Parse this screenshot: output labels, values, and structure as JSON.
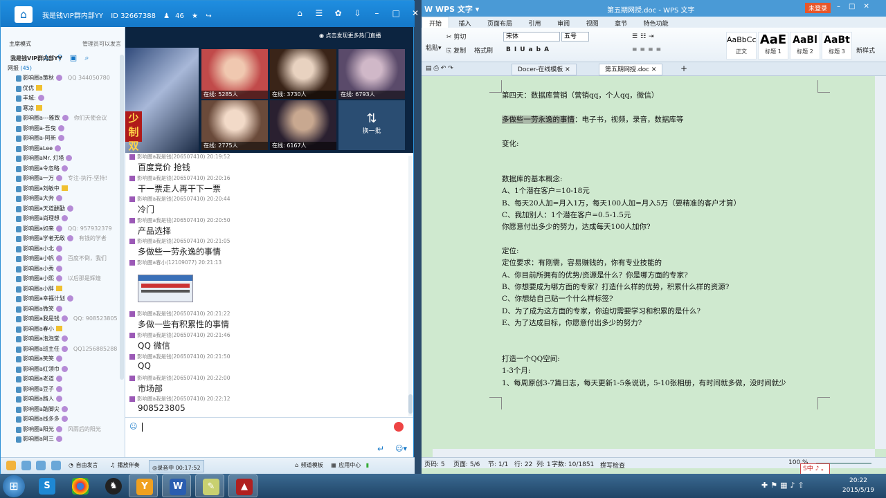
{
  "yy": {
    "title": "我是钱VIP群内部YY",
    "id": "ID 32667388",
    "online": "46",
    "mode": "主席模式",
    "admin_note": "管理员可以发言",
    "tree_root": "我是钱VIP群内部YY",
    "tree_sub": "网报",
    "tree_count": "(45)",
    "members": [
      {
        "name": "影响圈a策秋",
        "extra": "QQ  344050780",
        "badge": "b"
      },
      {
        "name": "优优",
        "extra": "",
        "badge": "g"
      },
      {
        "name": "丰城:",
        "extra": "",
        "badge": "b"
      },
      {
        "name": "寒凉",
        "extra": "",
        "badge": "g"
      },
      {
        "name": "影响圈a---雅致",
        "extra": "你们天使会议",
        "badge": "b"
      },
      {
        "name": "影响圈a-吾曳",
        "extra": "",
        "badge": "b"
      },
      {
        "name": "影响圈a-阿新",
        "extra": "",
        "badge": "b"
      },
      {
        "name": "影响圈aLee",
        "extra": "",
        "badge": "b"
      },
      {
        "name": "影响圈aMr. 灯塔",
        "extra": "",
        "badge": "b"
      },
      {
        "name": "影响圈a令忽略",
        "extra": "",
        "badge": "b"
      },
      {
        "name": "影响圈a一万",
        "extra": "专注-执行-坚持!",
        "badge": "b"
      },
      {
        "name": "影响圈a刘敏中",
        "extra": "",
        "badge": "g"
      },
      {
        "name": "影响圈a大奔",
        "extra": "",
        "badge": "b"
      },
      {
        "name": "影响圈a天道酬勤",
        "extra": "",
        "badge": "b"
      },
      {
        "name": "影响圈a尚理想",
        "extra": "",
        "badge": "b"
      },
      {
        "name": "影响圈a如来",
        "extra": "QQ: 957932379",
        "badge": "b"
      },
      {
        "name": "影响圈a学者无敌",
        "extra": "有钱的学者",
        "badge": "b"
      },
      {
        "name": "影响圈a小北",
        "extra": "",
        "badge": "b"
      },
      {
        "name": "影响圈a小帆",
        "extra": "百度不倒，我们",
        "badge": "b"
      },
      {
        "name": "影响圈a小秀",
        "extra": "",
        "badge": "b"
      },
      {
        "name": "影响圈a小熙",
        "extra": "以后那是辉煌",
        "badge": "b"
      },
      {
        "name": "影响圈a小胖",
        "extra": "",
        "badge": "g"
      },
      {
        "name": "影响圈a幸福计划",
        "extra": "",
        "badge": "b"
      },
      {
        "name": "影响圈a微笑",
        "extra": "",
        "badge": "b"
      },
      {
        "name": "影响圈a我是钱",
        "extra": "QQ: 908523805",
        "badge": "b"
      },
      {
        "name": "影响圈a春小",
        "extra": "",
        "badge": "g"
      },
      {
        "name": "影响圈a泡泡堂",
        "extra": "",
        "badge": "b"
      },
      {
        "name": "影响圈a班主任",
        "extra": "QQ1256885288",
        "badge": "b"
      },
      {
        "name": "影响圈a笑笑",
        "extra": "",
        "badge": "b"
      },
      {
        "name": "影响圈a红领巾",
        "extra": "",
        "badge": "b"
      },
      {
        "name": "影响圈a老道",
        "extra": "",
        "badge": "b"
      },
      {
        "name": "影响圈a豆子",
        "extra": "",
        "badge": "b"
      },
      {
        "name": "影响圈a路人",
        "extra": "",
        "badge": "b"
      },
      {
        "name": "影响圈a踮脚尖",
        "extra": "",
        "badge": "b"
      },
      {
        "name": "影响圈a线多多",
        "extra": "",
        "badge": "b"
      },
      {
        "name": "影响圈a阳光",
        "extra": "风雨后的阳光",
        "badge": "b"
      },
      {
        "name": "影响圈a阿三",
        "extra": "",
        "badge": "b"
      }
    ],
    "hot_live": "点击发现更多热门直播",
    "thumbs": [
      {
        "cap": "在线: 5285人",
        "c1": "#c14a4a",
        "c2": "#f0c8b0"
      },
      {
        "cap": "在线: 3730人",
        "c1": "#3a2418",
        "c2": "#e8d2c0"
      },
      {
        "cap": "在线: 6793人",
        "c1": "#5a4a6a",
        "c2": "#d0b8c8"
      },
      {
        "cap": "在线: 2775人",
        "c1": "#6a4a3a",
        "c2": "#f2dac8"
      },
      {
        "cap": "在线: 6167人",
        "c1": "#2a2030",
        "c2": "#c8a890"
      }
    ],
    "swap": "换一批",
    "banner_text": "少 制 双",
    "messages": [
      {
        "hdr": "影响圈a我是钱(206507410) 20:19:52",
        "txt": "百度竞价  抢钱"
      },
      {
        "hdr": "影响圈a我是钱(206507410) 20:20:16",
        "txt": "干一票走人再干下一票"
      },
      {
        "hdr": "影响圈a我是钱(206507410) 20:20:44",
        "txt": "冷门"
      },
      {
        "hdr": "影响圈a我是钱(206507410) 20:20:50",
        "txt": "产品选择"
      },
      {
        "hdr": "影响圈a我是钱(206507410) 20:21:05",
        "txt": "多做些一劳永逸的事情"
      },
      {
        "hdr": "影响圈a春小(12109077) 20:21:13",
        "txt": ""
      },
      {
        "hdr": "影响圈a我是钱(206507410) 20:21:22",
        "txt": "多做一些有积累性的事情"
      },
      {
        "hdr": "影响圈a我是钱(206507410) 20:21:46",
        "txt": "QQ  微信"
      },
      {
        "hdr": "影响圈a我是钱(206507410) 20:21:50",
        "txt": "QQ"
      },
      {
        "hdr": "影响圈a我是钱(206507410) 20:22:00",
        "txt": "市场部"
      },
      {
        "hdr": "影响圈a我是钱(206507410) 20:22:12",
        "txt": "908523805"
      }
    ],
    "bottom": {
      "free_talk": "自由发言",
      "play_music": "播放伴奏",
      "recording": "录音中 00:17:52",
      "channel_tpl": "频道模板",
      "app_center": "应用中心"
    }
  },
  "wps": {
    "app": "WPS 文字",
    "title": "第五期网授.doc - WPS 文字",
    "login": "未登录",
    "menu": [
      "开始",
      "插入",
      "页面布局",
      "引用",
      "审阅",
      "视图",
      "章节",
      "特色功能"
    ],
    "cut": "剪切",
    "copy": "复制",
    "paste": "粘贴",
    "format_painter": "格式刷",
    "font": "宋体",
    "size": "五号",
    "styles": [
      {
        "preview": "AaBbCc",
        "name": "正文"
      },
      {
        "preview": "AaE",
        "name": "标题 1"
      },
      {
        "preview": "AaBl",
        "name": "标题 2"
      },
      {
        "preview": "AaBt",
        "name": "标题 3"
      }
    ],
    "new_style": "新样式",
    "tabs": [
      "Docer-在线模板",
      "第五期网授.doc"
    ],
    "doc_lines": [
      "第四天：数据库营销（营销qq，个人qq，微信）",
      "多做些一劳永逸的事情",
      "：电子书，视频，录音，数据库等",
      "变化:",
      "数据库的基本概念:",
      "A、1个潜在客户=10-18元",
      "B、每天20人加=月入1万，每天100人加=月入5万（要精准的客户才算）",
      "C、我加别人：1个潜在客户=0.5-1.5元",
      "你愿意付出多少的努力，达成每天100人加你?",
      "定位:",
      "定位要求：有刚需，容易赚钱的，你有专业技能的",
      "A、你目前所拥有的优势/资源是什么？你是哪方面的专家?",
      "B、你想要成为哪方面的专家？打造什么样的优势，积累什么样的资源?",
      "C、你想给自己贴一个什么样标签?",
      "D、为了成为这方面的专家，你迫切需要学习和积累的是什么?",
      "E、为了达成目标，你愿意付出多少的努力?",
      "打造一个QQ空间:",
      "1-3个月:",
      "1、每周原创3-7篇日志，每天更新1-5条说说，5-10张相册，有时间就多做，没时间就少"
    ],
    "status": {
      "page": "页码: 5",
      "pages": "页面: 5/6",
      "section": "节: 1/1",
      "row": "行: 22",
      "col": "列: 1",
      "words": "字数: 10/1851",
      "spell": "拼写检查",
      "zoom": "100 %"
    }
  },
  "taskbar": {
    "time": "20:22",
    "date": "2015/5/19",
    "ime": "S中 ♪ 。"
  }
}
